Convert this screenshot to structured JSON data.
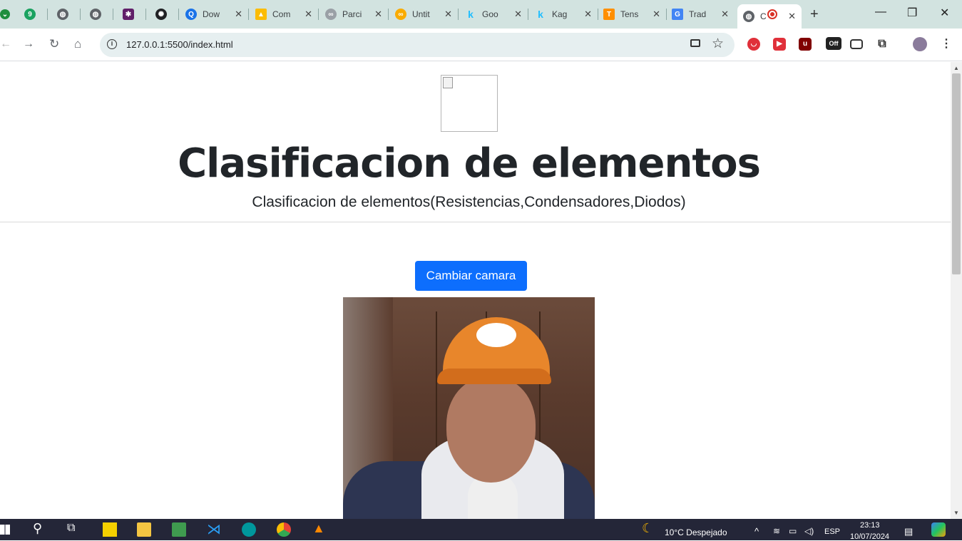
{
  "browser": {
    "tabs": [
      {
        "title": "",
        "icon": "g9-icon",
        "color": "#1aa260"
      },
      {
        "title": "",
        "icon": "globe-icon",
        "color": "#5f6368"
      },
      {
        "title": "",
        "icon": "globe-icon",
        "color": "#5f6368"
      },
      {
        "title": "",
        "icon": "slack-icon",
        "color": "#611f69"
      },
      {
        "title": "",
        "icon": "openai-icon",
        "color": "#202124"
      },
      {
        "title": "Dow",
        "icon": "search-icon",
        "color": "#1a73e8"
      },
      {
        "title": "Com",
        "icon": "drive-icon",
        "color": "#fbbc04"
      },
      {
        "title": "Parci",
        "icon": "colab-icon",
        "color": "#9aa0a6"
      },
      {
        "title": "Untit",
        "icon": "colab-icon",
        "color": "#f9ab00"
      },
      {
        "title": "Goo",
        "icon": "kaggle-icon",
        "color": "#20beff"
      },
      {
        "title": "Kag",
        "icon": "kaggle-icon",
        "color": "#20beff"
      },
      {
        "title": "Tens",
        "icon": "tensorflow-icon",
        "color": "#ff8f00"
      },
      {
        "title": "Trad",
        "icon": "translate-icon",
        "color": "#4285f4"
      },
      {
        "title": "C",
        "icon": "globe-icon",
        "color": "#5f6368"
      }
    ],
    "url": "127.0.0.1:5500/index.html",
    "window_controls": {
      "minimize": "—",
      "restore": "❐",
      "close": "✕"
    },
    "new_tab": "+",
    "ext_off_badge": "Off"
  },
  "page": {
    "title": "Clasificacion de elementos",
    "subtitle": "Clasificacion de elementos(Resistencias,Condensadores,Diodos)",
    "switch_camera_label": "Cambiar camara"
  },
  "taskbar": {
    "weather": "10°C  Despejado",
    "language": "ESP",
    "time": "23:13",
    "date": "10/07/2024"
  }
}
